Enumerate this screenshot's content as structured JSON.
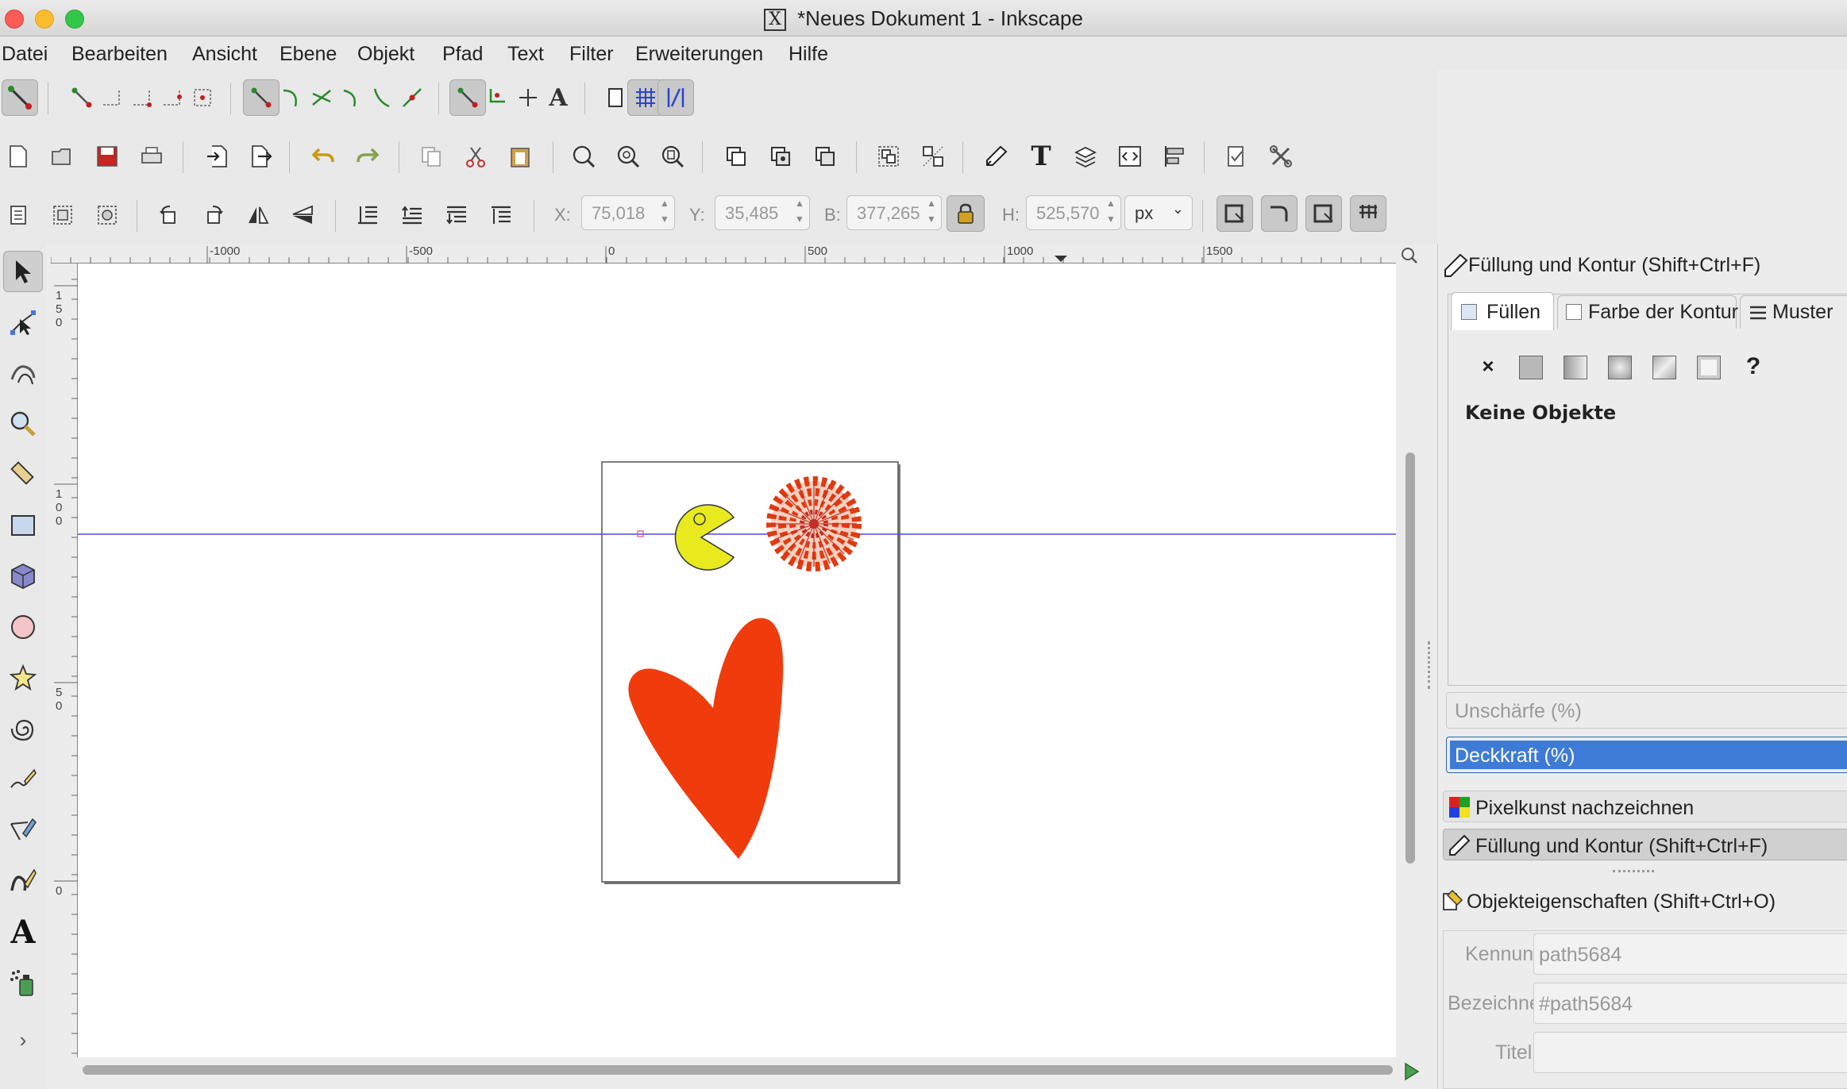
{
  "window": {
    "title": "*Neues Dokument 1 - Inkscape"
  },
  "menu": [
    "Datei",
    "Bearbeiten",
    "Ansicht",
    "Ebene",
    "Objekt",
    "Pfad",
    "Text",
    "Filter",
    "Erweiterungen",
    "Hilfe"
  ],
  "coords": {
    "x_label": "X:",
    "x_value": "75,018",
    "y_label": "Y:",
    "y_value": "35,485",
    "w_label": "B:",
    "w_value": "377,265",
    "h_label": "H:",
    "h_value": "525,570",
    "unit": "px"
  },
  "ruler_labels": [
    "-1000",
    "-500",
    "0",
    "500",
    "1000",
    "1500"
  ],
  "vruler_labels": [
    "150",
    "100",
    "50",
    "0"
  ],
  "fill_stroke": {
    "header": "Füllung und Kontur (Shift+Ctrl+F)",
    "tabs": [
      "Füllen",
      "Farbe der Kontur",
      "Muster"
    ],
    "status": "Keine Objekte",
    "blur_label": "Unschärfe (%)",
    "opacity_label": "Deckkraft (%)"
  },
  "dock": {
    "trace": "Pixelkunst nachzeichnen",
    "fill_stroke": "Füllung und Kontur (Shift+Ctrl+F)"
  },
  "object_props": {
    "header": "Objekteigenschaften (Shift+Ctrl+O)",
    "id_label": "Kennung:",
    "id_value": "path5684",
    "label_label": "Bezeichner:",
    "label_value": "#path5684",
    "title_label": "Titel:",
    "title_value": ""
  },
  "colors": {
    "pacman": "#e8ea1e",
    "heart": "#f03c0c",
    "mandala": "#e03a10",
    "guide": "#4b4bd6",
    "highlight": "#3d7bd7"
  }
}
